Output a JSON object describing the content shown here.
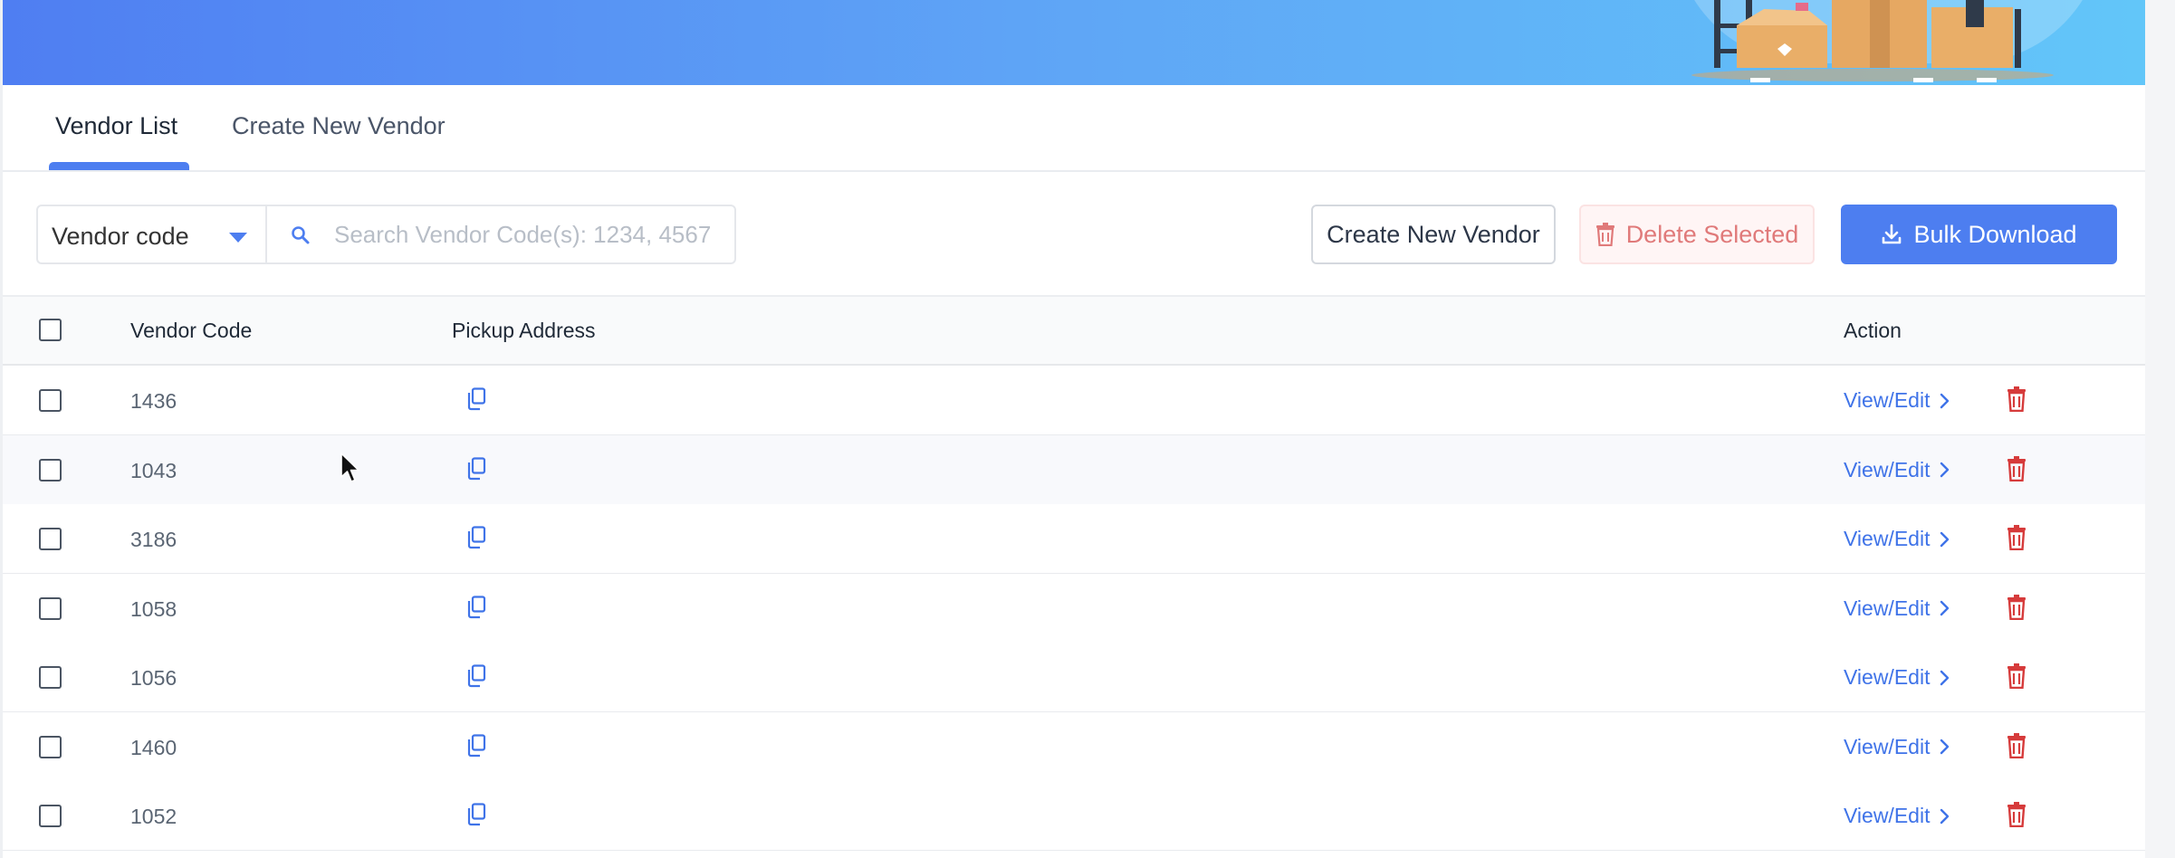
{
  "tabs": [
    {
      "label": "Vendor List",
      "active": true
    },
    {
      "label": "Create New Vendor",
      "active": false
    }
  ],
  "filter": {
    "selected": "Vendor code",
    "search_placeholder": "Search Vendor Code(s): 1234, 4567"
  },
  "toolbar": {
    "create_label": "Create New Vendor",
    "delete_label": "Delete Selected",
    "download_label": "Bulk Download"
  },
  "table": {
    "columns": [
      "Vendor Code",
      "Pickup Address",
      "Action"
    ],
    "rows": [
      {
        "code": "1436",
        "action": "View/Edit"
      },
      {
        "code": "1043",
        "action": "View/Edit"
      },
      {
        "code": "3186",
        "action": "View/Edit"
      },
      {
        "code": "1058",
        "action": "View/Edit"
      },
      {
        "code": "1056",
        "action": "View/Edit"
      },
      {
        "code": "1460",
        "action": "View/Edit"
      },
      {
        "code": "1052",
        "action": "View/Edit"
      }
    ]
  },
  "icons": {
    "search": "search-icon",
    "copy": "copy-icon",
    "chevron": "chevron-right-icon",
    "trash": "trash-icon",
    "download": "download-icon",
    "caret": "caret-down-icon"
  },
  "colors": {
    "primary": "#4d7ef0",
    "danger": "#d63b3b",
    "danger_soft": "#e07a7a",
    "link": "#3f73e8"
  }
}
